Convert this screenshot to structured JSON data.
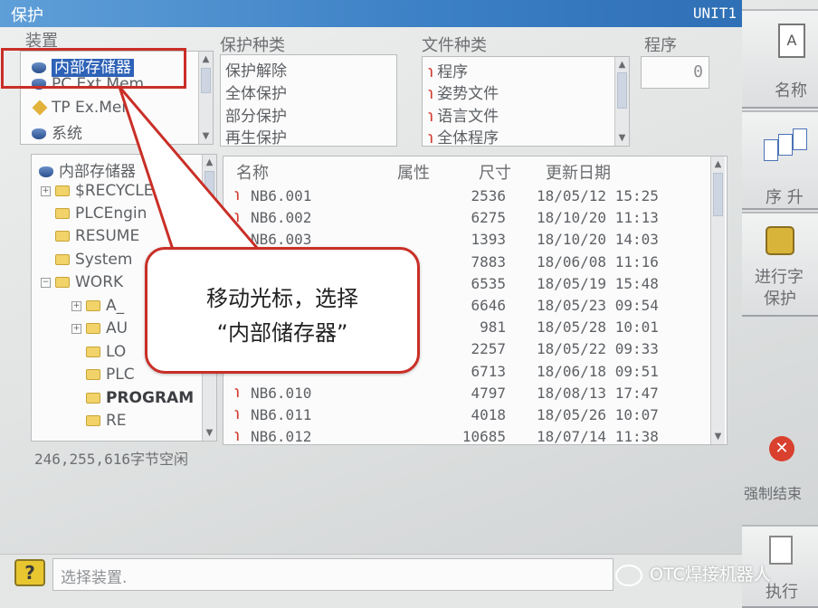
{
  "window": {
    "title": "保护",
    "unit": "UNIT1"
  },
  "sections": {
    "device_label": "装置",
    "protect_type_label": "保护种类",
    "file_type_label": "文件种类",
    "program_label": "程序",
    "program_value": "0"
  },
  "devices": [
    "内部存储器",
    "PC Ext.Mem",
    "TP Ex.Mem",
    "系统"
  ],
  "protect_types": [
    "保护解除",
    "全体保护",
    "部分保护",
    "再生保护"
  ],
  "file_types": [
    "程序",
    "姿势文件",
    "语言文件",
    "全体程序"
  ],
  "tree": {
    "root": "内部存储器",
    "items": [
      "$RECYCLE",
      "PLCEngin",
      "RESUME",
      "System",
      "WORK",
      "A_",
      "AU",
      "LO",
      "PLC",
      "PROGRAM",
      "RE"
    ]
  },
  "file_table": {
    "headers": [
      "名称",
      "属性",
      "尺寸",
      "更新日期"
    ],
    "rows": [
      {
        "name": "NB6.001",
        "size": "2536",
        "date": "18/05/12 15:25"
      },
      {
        "name": "NB6.002",
        "size": "6275",
        "date": "18/10/20 11:13"
      },
      {
        "name": "NB6.003",
        "size": "1393",
        "date": "18/10/20 14:03"
      },
      {
        "name": "",
        "size": "7883",
        "date": "18/06/08 11:16"
      },
      {
        "name": "",
        "size": "6535",
        "date": "18/05/19 15:48"
      },
      {
        "name": "",
        "size": "6646",
        "date": "18/05/23 09:54"
      },
      {
        "name": "",
        "size": "981",
        "date": "18/05/28 10:01"
      },
      {
        "name": "",
        "size": "2257",
        "date": "18/05/22 09:33"
      },
      {
        "name": "",
        "size": "6713",
        "date": "18/06/18 09:51"
      },
      {
        "name": "NB6.010",
        "size": "4797",
        "date": "18/08/13 17:47"
      },
      {
        "name": "NB6.011",
        "size": "4018",
        "date": "18/05/26 10:07"
      },
      {
        "name": "NB6.012",
        "size": "10685",
        "date": "18/07/14 11:38"
      }
    ]
  },
  "free_space": "246,255,616字节空闲",
  "side_buttons": {
    "name": "名称",
    "sort": "序 升",
    "exec1": "进行字",
    "exec2": "保护",
    "force_end": "强制结束",
    "exec": "执行"
  },
  "status_message": "选择装置.",
  "annotation": {
    "line1": "移动光标，选择",
    "line2": "“内部储存器”"
  },
  "watermark": "OTC焊接机器人",
  "colors": {
    "title_bar": "#3b7fc4",
    "selection": "#2e62b7",
    "callout_border": "#c92f27"
  }
}
